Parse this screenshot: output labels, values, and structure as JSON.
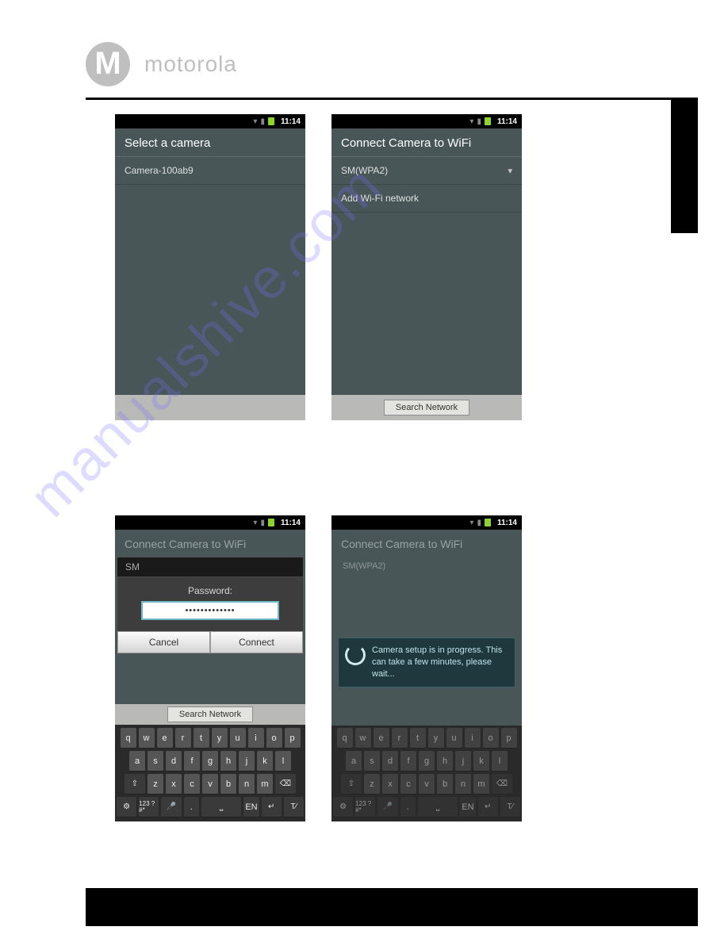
{
  "header": {
    "brand": "motorola"
  },
  "status_time": "11:14",
  "screens": {
    "select_camera": {
      "title": "Select a camera",
      "items": [
        "Camera-100ab9"
      ]
    },
    "connect_wifi_list": {
      "title": "Connect Camera to WiFi",
      "items": [
        {
          "label": "SM(WPA2)",
          "secure": true
        },
        {
          "label": "Add Wi-Fi network",
          "secure": false
        }
      ],
      "footer_button": "Search Network"
    },
    "password_dialog": {
      "title": "Connect Camera to WiFi",
      "network": "SM",
      "field_label": "Password:",
      "masked_value": "•••••••••••••",
      "buttons": {
        "cancel": "Cancel",
        "connect": "Connect"
      },
      "footer_button": "Search Network"
    },
    "progress": {
      "title": "Connect Camera to WiFi",
      "network": "SM(WPA2)",
      "toast": "Camera setup is in progress. This can take a few minutes, please wait..."
    }
  },
  "keyboard": {
    "row1": [
      "q",
      "w",
      "e",
      "r",
      "t",
      "y",
      "u",
      "i",
      "o",
      "p"
    ],
    "row2": [
      "a",
      "s",
      "d",
      "f",
      "g",
      "h",
      "j",
      "k",
      "l"
    ],
    "row3": [
      "z",
      "x",
      "c",
      "v",
      "b",
      "n",
      "m"
    ],
    "fn": {
      "sym": "123\n?#*",
      "lang": "EN"
    }
  }
}
